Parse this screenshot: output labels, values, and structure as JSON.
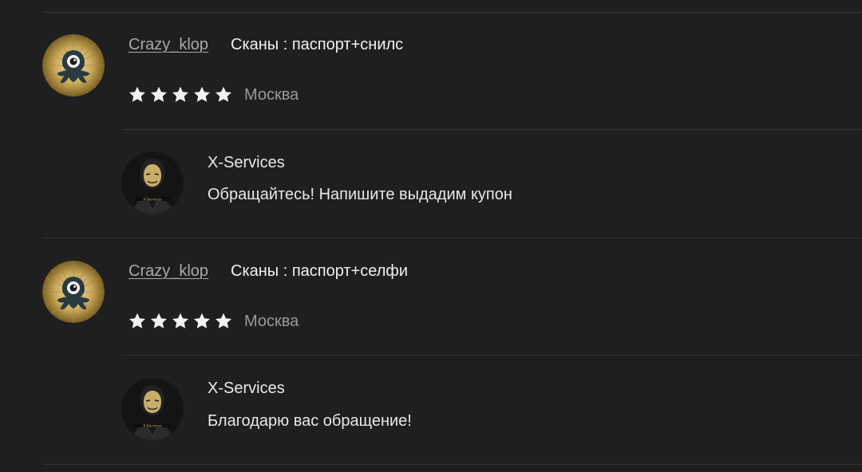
{
  "reviews": [
    {
      "author": "Crazy_klop",
      "title": "Сканы : паспорт+снилс",
      "rating": 5,
      "city": "Москва",
      "reply": {
        "author": "X-Services",
        "text": "Обращайтесь! Напишите выдадим купон"
      }
    },
    {
      "author": "Crazy_klop",
      "title": "Сканы : паспорт+селфи",
      "rating": 5,
      "city": "Москва",
      "reply": {
        "author": "X-Services",
        "text": "Благодарю вас обращение!"
      }
    }
  ],
  "icons": {
    "review_avatar": "cyclops-octopus-avatar-icon",
    "reply_avatar": "masked-figure-avatar-icon",
    "star": "star-icon"
  },
  "colors": {
    "background": "#1f1f1f",
    "divider": "#343434",
    "star": "#f2f2f2",
    "muted_text": "#9a9a9a"
  }
}
